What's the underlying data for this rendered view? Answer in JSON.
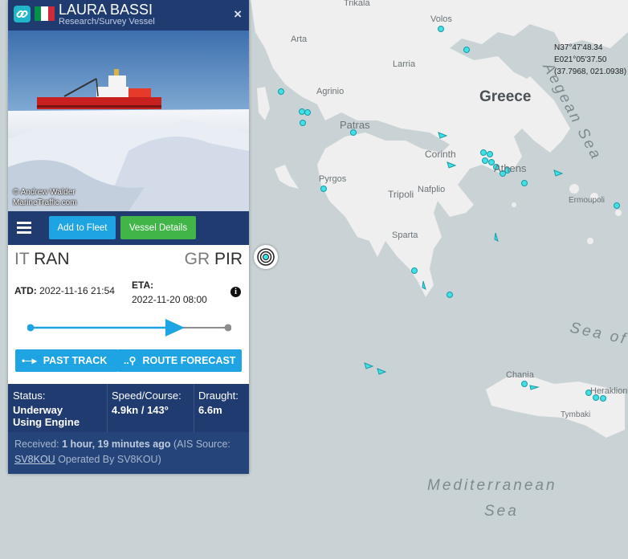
{
  "vessel": {
    "name": "LAURA BASSI",
    "type": "Research/Survey Vessel",
    "flag_colors": [
      "#009246",
      "#ffffff",
      "#ce2b37"
    ],
    "close_icon": "×",
    "photo_credit_1": "© Andrew Walder",
    "photo_credit_2": "MarineTraffic.com"
  },
  "toolbar": {
    "menu_icon": "hamburger-menu-icon",
    "add_to_fleet": "Add to Fleet",
    "vessel_details": "Vessel Details"
  },
  "voyage": {
    "from_cc": "IT",
    "from_port": "RAN",
    "to_cc": "GR",
    "to_port": "PIR",
    "atd_label": "ATD:",
    "atd_value": "2022-11-16 21:54",
    "eta_label": "ETA:",
    "eta_value": "2022-11-20 08:00",
    "progress_percent": 78,
    "past_track": "PAST TRACK",
    "route_forecast": "ROUTE FORECAST"
  },
  "stats": {
    "status_label": "Status:",
    "status_line1": "Underway",
    "status_line2": "Using Engine",
    "speed_label": "Speed/Course:",
    "speed_value": "4.9kn / 143º",
    "draught_label": "Draught:",
    "draught_value": "6.6m"
  },
  "received": {
    "prefix": "Received:",
    "age": "1 hour, 19 minutes ago",
    "mid": "(AIS",
    "source_prefix": "Source:",
    "source": "SV8KOU",
    "suffix": "Operated By SV8KOU)"
  },
  "map": {
    "coord_lat": "N37°47'48.34",
    "coord_lon": "E021°05'37.50",
    "coord_dec": "(37.7968, 021.0938)",
    "labels": {
      "trikala": "Trikala",
      "volos": "Volos",
      "arta": "Arta",
      "larissa": "Larria",
      "agrinio": "Agrinio",
      "greece": "Greece",
      "patras": "Patras",
      "corinth": "Corinth",
      "athens": "Athens",
      "pyrgos": "Pyrgos",
      "tripoli": "Tripoli",
      "nafplio": "Nafplio",
      "ermoupoli": "Ermoupoli",
      "sparta": "Sparta",
      "chania": "Chania",
      "heraklion": "Heraklion",
      "tymbaki": "Tymbaki",
      "aegean": "Aegean Sea",
      "sea_of": "Sea of",
      "med1": "Mediterranean",
      "med2": "Sea"
    }
  }
}
